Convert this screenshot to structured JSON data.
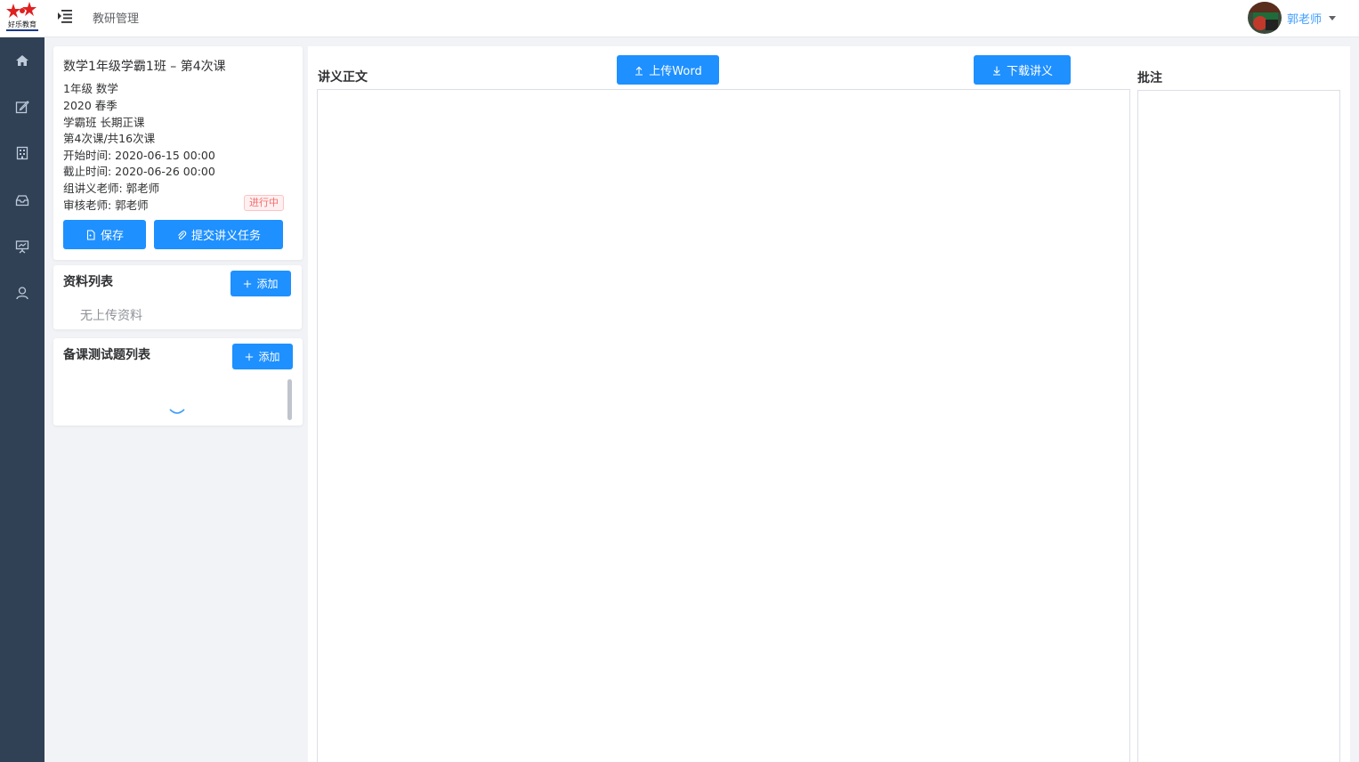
{
  "app": {
    "logo_text": "好乐教育",
    "breadcrumb": "教研管理"
  },
  "user": {
    "name": "郭老师"
  },
  "sidebar": {
    "items": [
      {
        "icon": "home-icon"
      },
      {
        "icon": "edit-icon"
      },
      {
        "icon": "building-icon"
      },
      {
        "icon": "inbox-icon"
      },
      {
        "icon": "presentation-icon"
      },
      {
        "icon": "user-icon"
      }
    ]
  },
  "course": {
    "title": "数学1年级学霸1班 – 第4次课",
    "grade_subject": "1年级  数学",
    "year_term": "2020  春季",
    "class_type": "学霸班  长期正课",
    "lesson_progress": "第4次课/共16次课",
    "start_time": "开始时间: 2020-06-15 00:00",
    "end_time": "截止时间: 2020-06-26 00:00",
    "organizer": "组讲义老师: 郭老师",
    "reviewer": "审核老师: 郭老师",
    "status": "进行中",
    "save_label": "保存",
    "submit_label": "提交讲义任务"
  },
  "materials": {
    "title": "资料列表",
    "add_label": "添加",
    "empty_text": "无上传资料"
  },
  "quiz": {
    "title": "备课测试题列表",
    "add_label": "添加"
  },
  "lecture": {
    "title": "讲义正文",
    "upload_label": "上传Word",
    "download_label": "下载讲义"
  },
  "annotation": {
    "title": "批注"
  },
  "colors": {
    "primary": "#1e90ff",
    "sidebar_bg": "#304156",
    "status_red": "#f56c6c"
  }
}
